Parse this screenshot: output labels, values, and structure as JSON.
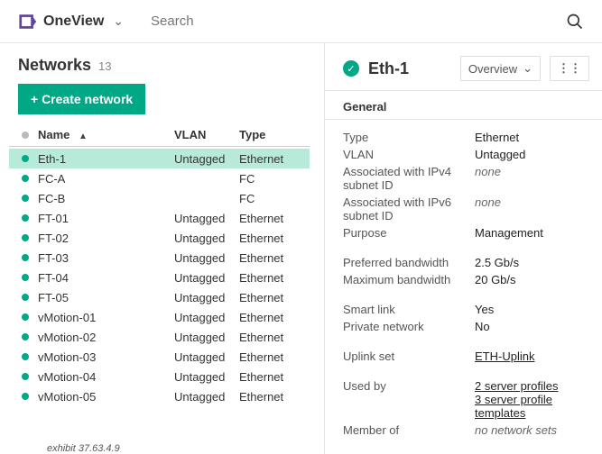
{
  "header": {
    "app_name": "OneView",
    "search_placeholder": "Search"
  },
  "page": {
    "title": "Networks",
    "count": "13",
    "create_label": "+  Create network",
    "exhibit": "exhibit 37.63.4.9"
  },
  "table": {
    "columns": {
      "name": "Name",
      "vlan": "VLAN",
      "type": "Type"
    },
    "rows": [
      {
        "name": "Eth-1",
        "vlan": "Untagged",
        "type": "Ethernet",
        "selected": true
      },
      {
        "name": "FC-A",
        "vlan": "",
        "type": "FC"
      },
      {
        "name": "FC-B",
        "vlan": "",
        "type": "FC"
      },
      {
        "name": "FT-01",
        "vlan": "Untagged",
        "type": "Ethernet"
      },
      {
        "name": "FT-02",
        "vlan": "Untagged",
        "type": "Ethernet"
      },
      {
        "name": "FT-03",
        "vlan": "Untagged",
        "type": "Ethernet"
      },
      {
        "name": "FT-04",
        "vlan": "Untagged",
        "type": "Ethernet"
      },
      {
        "name": "FT-05",
        "vlan": "Untagged",
        "type": "Ethernet"
      },
      {
        "name": "vMotion-01",
        "vlan": "Untagged",
        "type": "Ethernet"
      },
      {
        "name": "vMotion-02",
        "vlan": "Untagged",
        "type": "Ethernet"
      },
      {
        "name": "vMotion-03",
        "vlan": "Untagged",
        "type": "Ethernet"
      },
      {
        "name": "vMotion-04",
        "vlan": "Untagged",
        "type": "Ethernet"
      },
      {
        "name": "vMotion-05",
        "vlan": "Untagged",
        "type": "Ethernet"
      }
    ]
  },
  "detail": {
    "title": "Eth-1",
    "view_label": "Overview",
    "section": "General",
    "groups": [
      [
        {
          "k": "Type",
          "v": "Ethernet"
        },
        {
          "k": "VLAN",
          "v": "Untagged"
        },
        {
          "k": "Associated with IPv4 subnet ID",
          "v": "none",
          "italic": true
        },
        {
          "k": "Associated with IPv6 subnet ID",
          "v": "none",
          "italic": true
        },
        {
          "k": "Purpose",
          "v": "Management"
        }
      ],
      [
        {
          "k": "Preferred bandwidth",
          "v": "2.5 Gb/s"
        },
        {
          "k": "Maximum bandwidth",
          "v": "20 Gb/s"
        }
      ],
      [
        {
          "k": "Smart link",
          "v": "Yes"
        },
        {
          "k": "Private network",
          "v": "No"
        }
      ],
      [
        {
          "k": "Uplink set",
          "v": "ETH-Uplink",
          "link": true
        }
      ],
      [
        {
          "k": "Used by",
          "links": [
            "2 server profiles",
            "3 server profile templates"
          ]
        },
        {
          "k": "Member of",
          "v": "no network sets",
          "italic": true
        }
      ]
    ]
  }
}
